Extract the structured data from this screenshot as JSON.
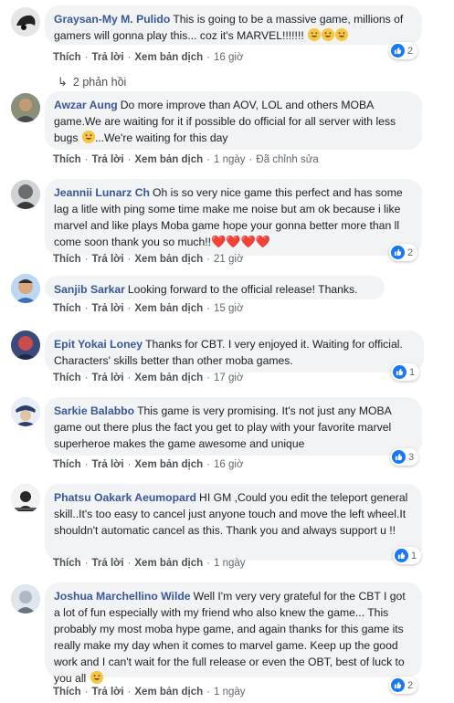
{
  "actions": {
    "like": "Thích",
    "reply": "Trả lời",
    "translate": "Xem bản dịch",
    "edited": "Đã chỉnh sửa"
  },
  "replies_toggle": {
    "icon": "reply-arrow-icon",
    "label": "2 phản hồi"
  },
  "comments": [
    {
      "author": "Graysan-My M. Pulido",
      "text": "This is going to be a massive game, millions of gamers will gonna play this... coz it's MARVEL!!!!!!! ",
      "emoji": [
        "grinning-face",
        "grinning-face",
        "grinning-face"
      ],
      "time": "16 giờ",
      "likes": "2"
    },
    {
      "author": "Awzar Aung",
      "text": "Do more improve than AOV, LOL and others MOBA game.We are waiting for it if possible do official for all server with less bugs ",
      "text_after": "...We're waiting for this day",
      "emoji": [
        "grinning-face"
      ],
      "time": "1 ngày",
      "edited": true
    },
    {
      "author": "Jeannii Lunarz Ch",
      "text": "Oh is so very nice game this perfect and has some lag a litle with ping some time make me noise but am ok because i like marvel and like plays Moba game hope your gonna better more than ll come soon thank you so much!!",
      "hearts": "❤️❤️❤️❤️",
      "time": "21 giờ",
      "likes": "2"
    },
    {
      "author": "Sanjib Sarkar",
      "text": "Looking forward to the official release! Thanks.",
      "time": "15 giờ"
    },
    {
      "author": "Epit Yokai Loney",
      "text": "Thanks for CBT. I very enjoyed it. Waiting for official. Characters' skills better than other moba games.",
      "time": "17 giờ",
      "likes": "1"
    },
    {
      "author": "Sarkie Balabbo",
      "text": "This game is very promising. It's not just any MOBA game out there plus the fact you get to play with your favorite marvel superheroe makes the game awesome and unique",
      "time": "16 giờ",
      "likes": "3"
    },
    {
      "author": "Phatsu Oakark Aeumopard",
      "text": "HI GM ,Could you edit the teleport general skill..It's too easy to cancel just anyone touch and move the left wheel.It shouldn't automatic cancel as this. Thank you and always support u !!",
      "time": "1 ngày",
      "likes": "1"
    },
    {
      "author": "Joshua Marchellino Wilde",
      "text": "Well I'm very very grateful for the CBT I got a lot of fun especially with my friend who also knew the game... This probably my most moba hype game, and again thanks for this game its really make my day when it comes to marvel game. Keep up the good work and I can't wait for the full release or even the OBT, best of luck to you all ",
      "emoji": [
        "grinning-face"
      ],
      "time": "1 ngày",
      "likes": "2"
    }
  ],
  "colors": {
    "author": "#385898",
    "bubble": "#f2f3f5",
    "like_badge": "#1877f2",
    "meta": "#606770"
  }
}
